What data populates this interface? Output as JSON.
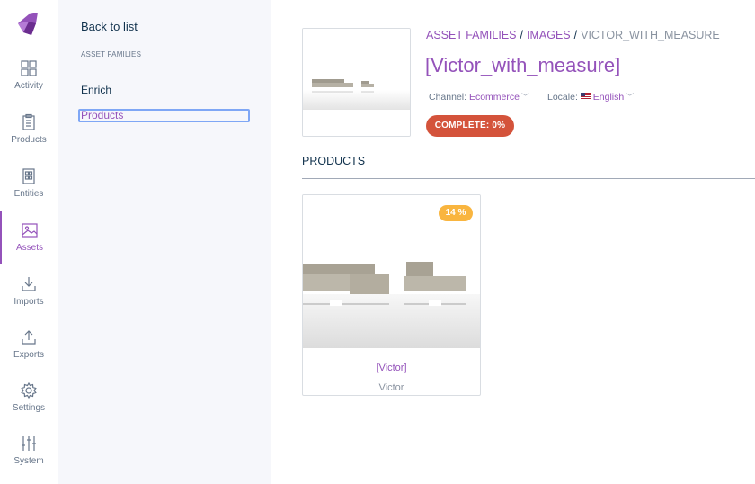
{
  "nav": {
    "items": [
      {
        "label": "Activity",
        "icon": "activity-grid-icon"
      },
      {
        "label": "Products",
        "icon": "clipboard-icon"
      },
      {
        "label": "Entities",
        "icon": "entities-icon"
      },
      {
        "label": "Assets",
        "icon": "image-icon",
        "active": true
      },
      {
        "label": "Imports",
        "icon": "download-icon"
      },
      {
        "label": "Exports",
        "icon": "upload-icon"
      },
      {
        "label": "Settings",
        "icon": "gear-icon"
      },
      {
        "label": "System",
        "icon": "sliders-icon"
      }
    ]
  },
  "subnav": {
    "back_label": "Back to list",
    "section_title": "ASSET FAMILIES",
    "items": [
      {
        "label": "Enrich"
      },
      {
        "label": "Products",
        "selected": true
      }
    ]
  },
  "header": {
    "breadcrumb": [
      "ASSET FAMILIES",
      "IMAGES",
      "VICTOR_WITH_MEASURE"
    ],
    "separator": "/",
    "title": "[Victor_with_measure]",
    "channel_label": "Channel:",
    "channel_value": "Ecommerce",
    "locale_label": "Locale:",
    "locale_value": "English",
    "completeness_badge": "COMPLETE: 0%"
  },
  "products": {
    "section_label": "PRODUCTS",
    "items": [
      {
        "title": "[Victor]",
        "subtitle": "Victor",
        "completeness": "14 %"
      }
    ]
  },
  "colors": {
    "accent": "#9452ba",
    "text": "#11324d",
    "danger": "#d4533b",
    "warning": "#f9b53f"
  }
}
